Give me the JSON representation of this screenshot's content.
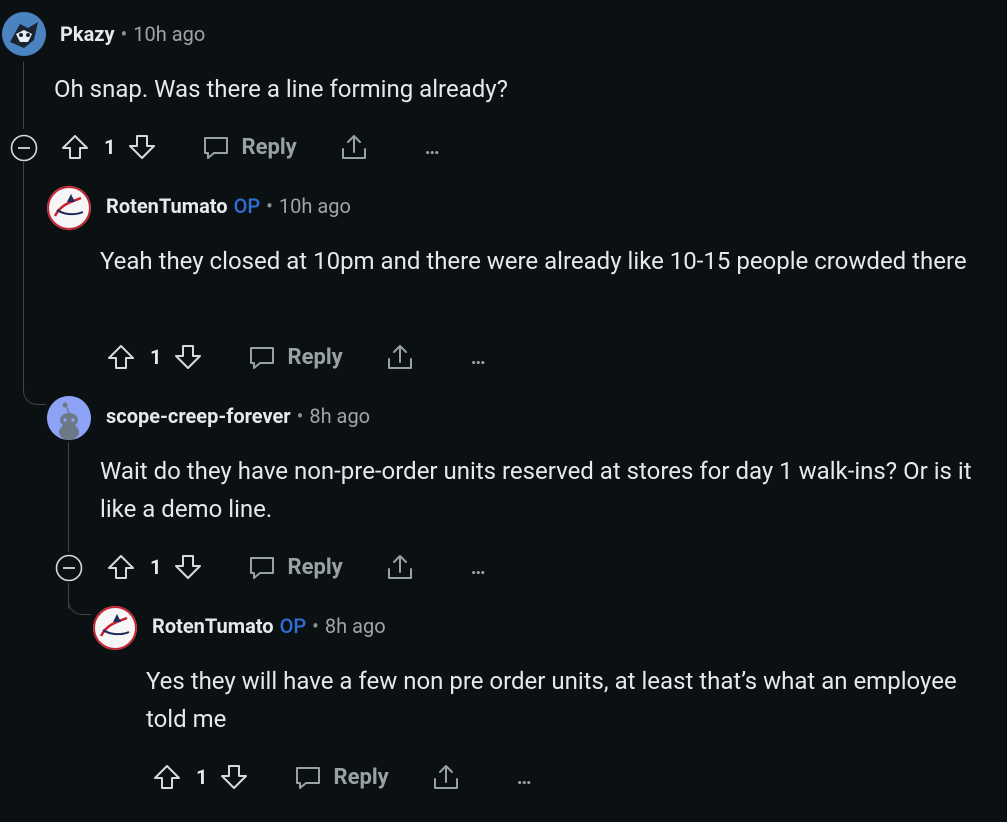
{
  "comments": [
    {
      "author": "Pkazy",
      "time": "10h ago",
      "text": "Oh snap. Was there a line forming already?",
      "votes": "1",
      "reply": "Reply",
      "more": "…"
    },
    {
      "author": "RotenTumato",
      "op": "OP",
      "time": "10h ago",
      "text": "Yeah they closed at 10pm and there were already like 10-15 people crowded there",
      "votes": "1",
      "reply": "Reply",
      "more": "…"
    },
    {
      "author": "scope-creep-forever",
      "time": "8h ago",
      "text": "Wait do they have non-pre-order units reserved at stores for day 1 walk-ins? Or is it like a demo line.",
      "votes": "1",
      "reply": "Reply",
      "more": "…"
    },
    {
      "author": "RotenTumato",
      "op": "OP",
      "time": "8h ago",
      "text": "Yes they will have a few non pre order units, at least that’s what an employee told me",
      "votes": "1",
      "reply": "Reply",
      "more": "…"
    }
  ],
  "colors": {
    "background": "#0b1012",
    "op": "#2f6fd8",
    "muted": "#9aa1a5"
  },
  "icons": [
    "collapse-icon",
    "upvote-icon",
    "downvote-icon",
    "reply-icon",
    "share-icon",
    "more-icon"
  ]
}
